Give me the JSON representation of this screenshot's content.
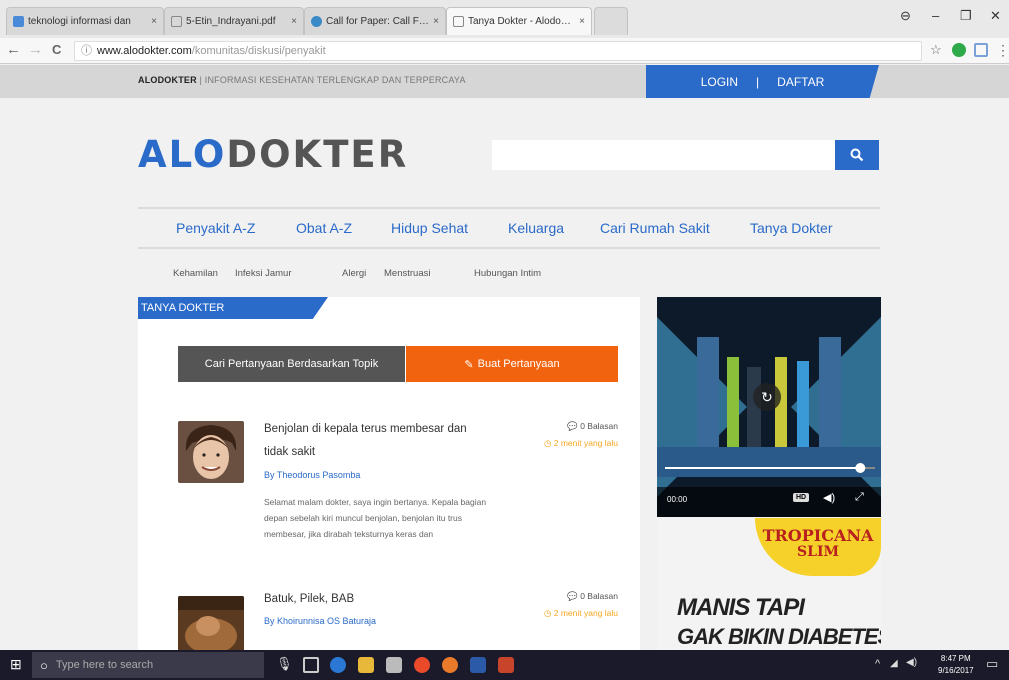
{
  "browser": {
    "tabs": [
      {
        "label": "teknologi informasi dan",
        "close": "×",
        "color": "#4a8ad8"
      },
      {
        "label": "5-Etin_Indrayani.pdf",
        "close": "×",
        "color": "#999"
      },
      {
        "label": "Call for Paper: Call For Pa",
        "close": "×",
        "color": "#3a8ac8"
      },
      {
        "label": "Tanya Dokter - Alodokter",
        "close": "×",
        "color": "#999"
      }
    ],
    "window_controls": {
      "profile": "⊖",
      "minimize": "–",
      "restore": "❐",
      "close": "✕"
    },
    "nav": {
      "back": "←",
      "forward": "→",
      "reload": "C"
    },
    "url": {
      "info": "ⓘ",
      "host": "www.alodokter.com",
      "path": "/komunitas/diskusi/penyakit"
    },
    "star": "☆",
    "menu": "⋮"
  },
  "site": {
    "tagline_brand": "ALODOKTER",
    "tagline_rest": " | INFORMASI KESEHATAN TERLENGKAP DAN TERPERCAYA",
    "login": "LOGIN",
    "separator": "|",
    "register": "DAFTAR",
    "logo_alo": "ALO",
    "logo_dokter": "DOKTER",
    "search_placeholder": "",
    "accent": "#2a6ac8",
    "orange": "#f2630f",
    "main_nav": [
      "Penyakit A-Z",
      "Obat A-Z",
      "Hidup Sehat",
      "Keluarga",
      "Cari Rumah Sakit",
      "Tanya Dokter"
    ],
    "sub_nav": [
      "Kehamilan",
      "Infeksi Jamur",
      "Alergi",
      "Menstruasi",
      "Hubungan Intim"
    ]
  },
  "content": {
    "section_label": "TANYA DOKTER",
    "search_topic_btn": "Cari Pertanyaan Berdasarkan Topik",
    "ask_btn": "Buat Pertanyaan",
    "questions": [
      {
        "title": "Benjolan di kepala terus membesar dan tidak sakit",
        "by": "By Theodorus Pasomba",
        "excerpt": "Selamat malam dokter, saya ingin bertanya. Kepala bagian depan sebelah kiri muncul benjolan, benjolan itu trus membesar, jika dirabah teksturnya keras dan",
        "replies": "0 Balasan",
        "time": "2 menit yang lalu"
      },
      {
        "title": "Batuk, Pilek, BAB",
        "by": "By Khoirunnisa OS Baturaja",
        "excerpt": "",
        "replies": "0 Balasan",
        "time": "2 menit yang lalu"
      }
    ]
  },
  "video": {
    "time": "00:00",
    "hd": "HD",
    "progress": 0.93
  },
  "ad": {
    "brand_line1": "TROPICANA",
    "brand_line2": "SLIM",
    "headline1": "MANIS TAPI",
    "headline2": "GAK BIKIN DIABETES?"
  },
  "taskbar": {
    "search_placeholder": "Type here to search",
    "time": "8:47 PM",
    "date": "9/16/2017"
  }
}
